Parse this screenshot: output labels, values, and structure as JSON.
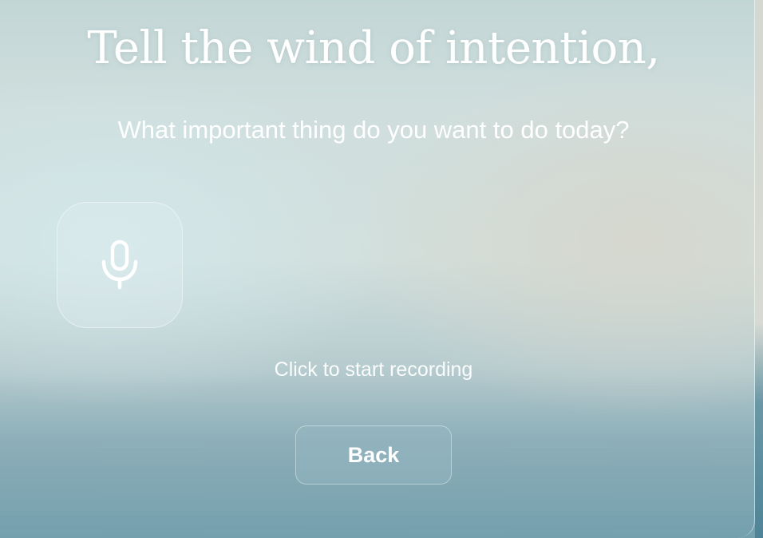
{
  "header": {
    "title": "Tell the wind of intention,",
    "subtitle": "What important thing do you want to do today?"
  },
  "recorder": {
    "icon": "microphone-icon",
    "hint": "Click to start recording"
  },
  "actions": {
    "back_label": "Back"
  }
}
